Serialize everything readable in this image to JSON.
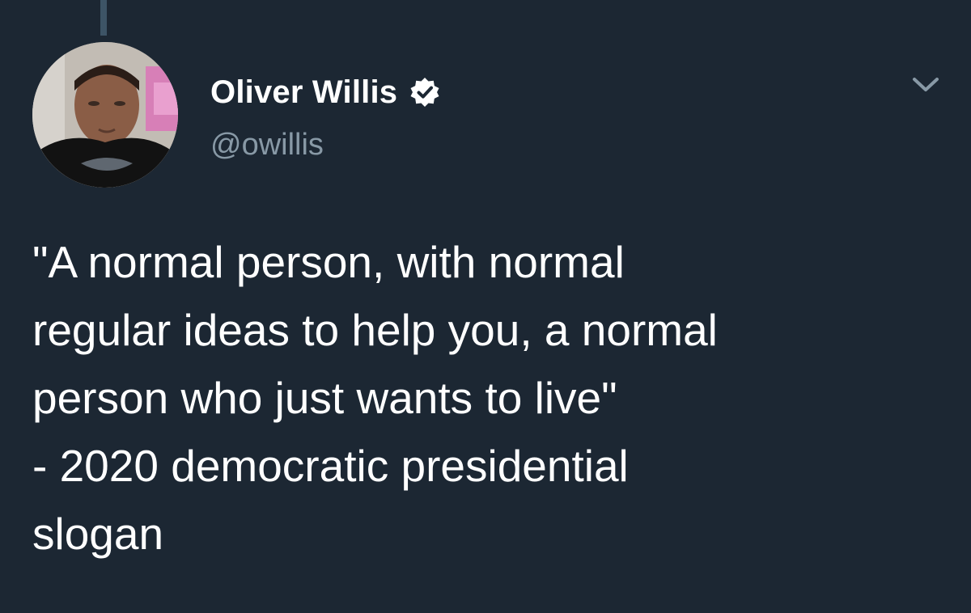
{
  "author": {
    "display_name": "Oliver Willis",
    "handle": "@owillis",
    "verified_icon": "verified-badge-icon",
    "avatar_icon": "profile-photo"
  },
  "menu": {
    "icon": "chevron-down-icon"
  },
  "tweet": {
    "lines": [
      "\"A normal person, with normal",
      "regular ideas to help you, a normal",
      "person who just wants to live\"",
      "- 2020 democratic presidential",
      "slogan"
    ]
  },
  "colors": {
    "background": "#1c2733",
    "primary_text": "#ffffff",
    "secondary_text": "#8899a6",
    "thread_line": "#3d5466"
  }
}
